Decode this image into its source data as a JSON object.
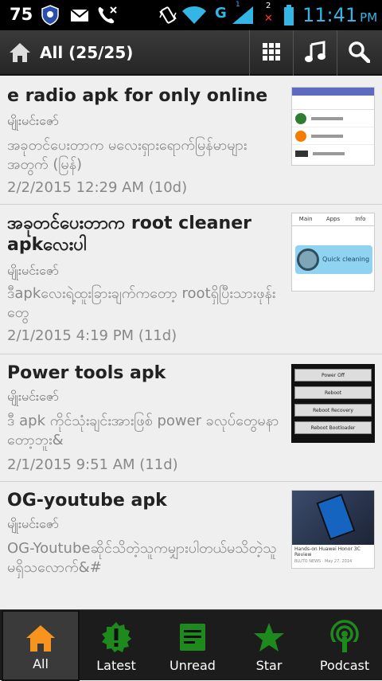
{
  "status_bar": {
    "notification_count": "75",
    "clock_time": "11:41",
    "clock_ampm": "PM",
    "network_label": "G",
    "sim1_label": "1",
    "sim2_label": "2",
    "accent_color": "#33b5e5"
  },
  "action_bar": {
    "title": "All (25/25)"
  },
  "articles": [
    {
      "title": "e radio apk for only online",
      "author": "မျိုးမင်းဇော်",
      "excerpt": "အခုတင်ပေးတာက မလေးရှားရောက်မြန်မာများအတွက် (မြန်)",
      "date": "2/2/2015 12:29 AM (10d)"
    },
    {
      "title": "အခုတင်ပေးတာက root cleaner apkလေးပါ",
      "author": "မျိုးမင်းဇော်",
      "excerpt": "ဒီapkလေးရဲ့ထူးခြားချက်ကတော့ rootရှိပြီးသားဖုန်းတွေ",
      "date": "2/1/2015 4:19 PM (11d)",
      "thumb_tabs": [
        "Main",
        "Apps",
        "Info"
      ],
      "thumb_banner": "Quick cleaning"
    },
    {
      "title": "Power tools apk",
      "author": "မျိုးမင်းဇော်",
      "excerpt": "ဒီ apk ကိုင်သုံးချင်းအားဖြစ် power ခလုပ်တွေမနာတော့ဘူး&",
      "date": "2/1/2015 9:51 AM (11d)",
      "thumb_buttons": [
        "Power Off",
        "Reboot",
        "Reboot Recovery",
        "Reboot Bootloader"
      ]
    },
    {
      "title": "OG-youtube apk",
      "author": "မျိုးမင်းဇော်",
      "excerpt": "OG-Youtubeဆိုင်သိတဲ့သူကမျှားပါတယ်မသိတဲ့သူမရှိသလောက်&#",
      "thumb_caption": "Hands-on Huawei Honor 3C Review",
      "thumb_meta": "BLUTO NEWS · May 27, 2014"
    }
  ],
  "bottom_nav": [
    {
      "label": "All",
      "icon": "home-icon",
      "color": "#f7941d"
    },
    {
      "label": "Latest",
      "icon": "alert-badge-icon",
      "color": "#1e8a1e"
    },
    {
      "label": "Unread",
      "icon": "document-icon",
      "color": "#1e8a1e"
    },
    {
      "label": "Star",
      "icon": "star-icon",
      "color": "#1e8a1e"
    },
    {
      "label": "Podcast",
      "icon": "podcast-icon",
      "color": "#1e8a1e"
    }
  ]
}
